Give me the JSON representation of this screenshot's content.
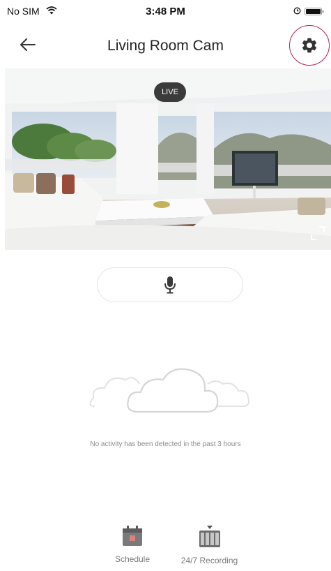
{
  "status_bar": {
    "carrier": "No SIM",
    "time": "3:48 PM",
    "icons": [
      "wifi-icon",
      "alarm-icon",
      "battery-icon"
    ]
  },
  "nav": {
    "back_icon": "back-arrow-icon",
    "title": "Living Room Cam",
    "settings_icon": "gear-icon",
    "settings_highlight_color": "#b0244a"
  },
  "feed": {
    "badge": "LIVE",
    "fullscreen_icon": "fullscreen-icon"
  },
  "talk": {
    "icon": "microphone-icon"
  },
  "empty_state": {
    "illustration": "clouds-icon",
    "message": "No activity has been detected in the past 3 hours"
  },
  "bottom_actions": [
    {
      "label": "Schedule",
      "icon": "calendar-icon",
      "accent": "#d98080"
    },
    {
      "label": "24/7 Recording",
      "icon": "film-strip-icon"
    }
  ]
}
